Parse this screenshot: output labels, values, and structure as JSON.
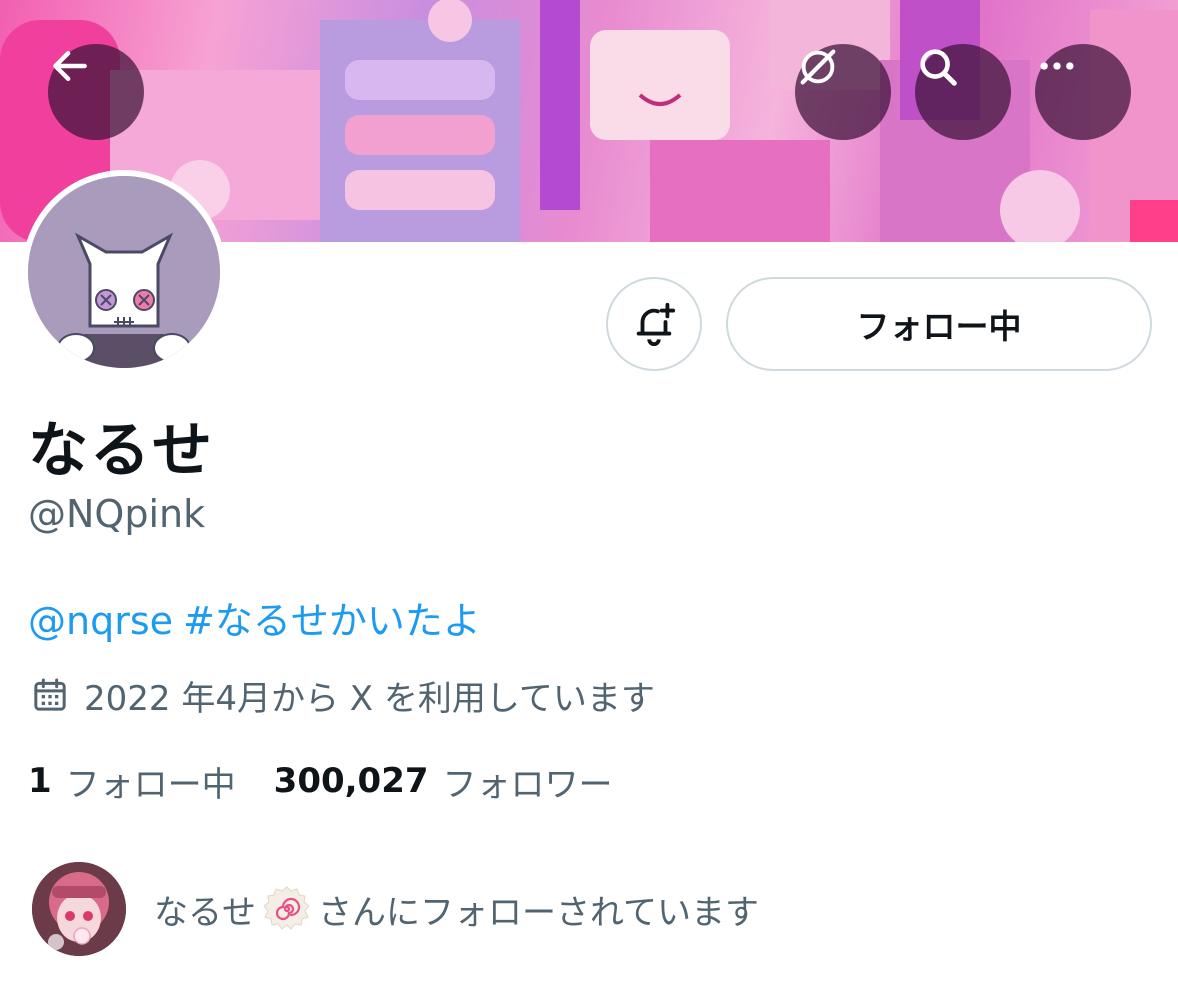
{
  "header": {
    "back_icon": "arrow-left-icon",
    "grok_icon": "grok-icon",
    "search_icon": "search-icon",
    "more_icon": "more-horizontal-icon"
  },
  "profile": {
    "display_name": "なるせ",
    "handle": "@NQpink",
    "bio_mention": "@nqrse",
    "bio_hashtag": "#なるせかいたよ",
    "joined_icon": "calendar-icon",
    "joined_text": "2022 年4月から X を利用しています"
  },
  "actions": {
    "notify_icon": "bell-plus-icon",
    "follow_label": "フォロー中"
  },
  "stats": {
    "following_count": "1",
    "following_label": "フォロー中",
    "followers_count": "300,027",
    "followers_label": "フォロワー"
  },
  "followed_by": {
    "name": "なるせ",
    "emoji": "naruto-fishcake-icon",
    "suffix": "さんにフォローされています"
  },
  "colors": {
    "link": "#1d9bf0",
    "secondary_text": "#536471",
    "primary_text": "#0f1419",
    "border": "#cfd9de"
  }
}
